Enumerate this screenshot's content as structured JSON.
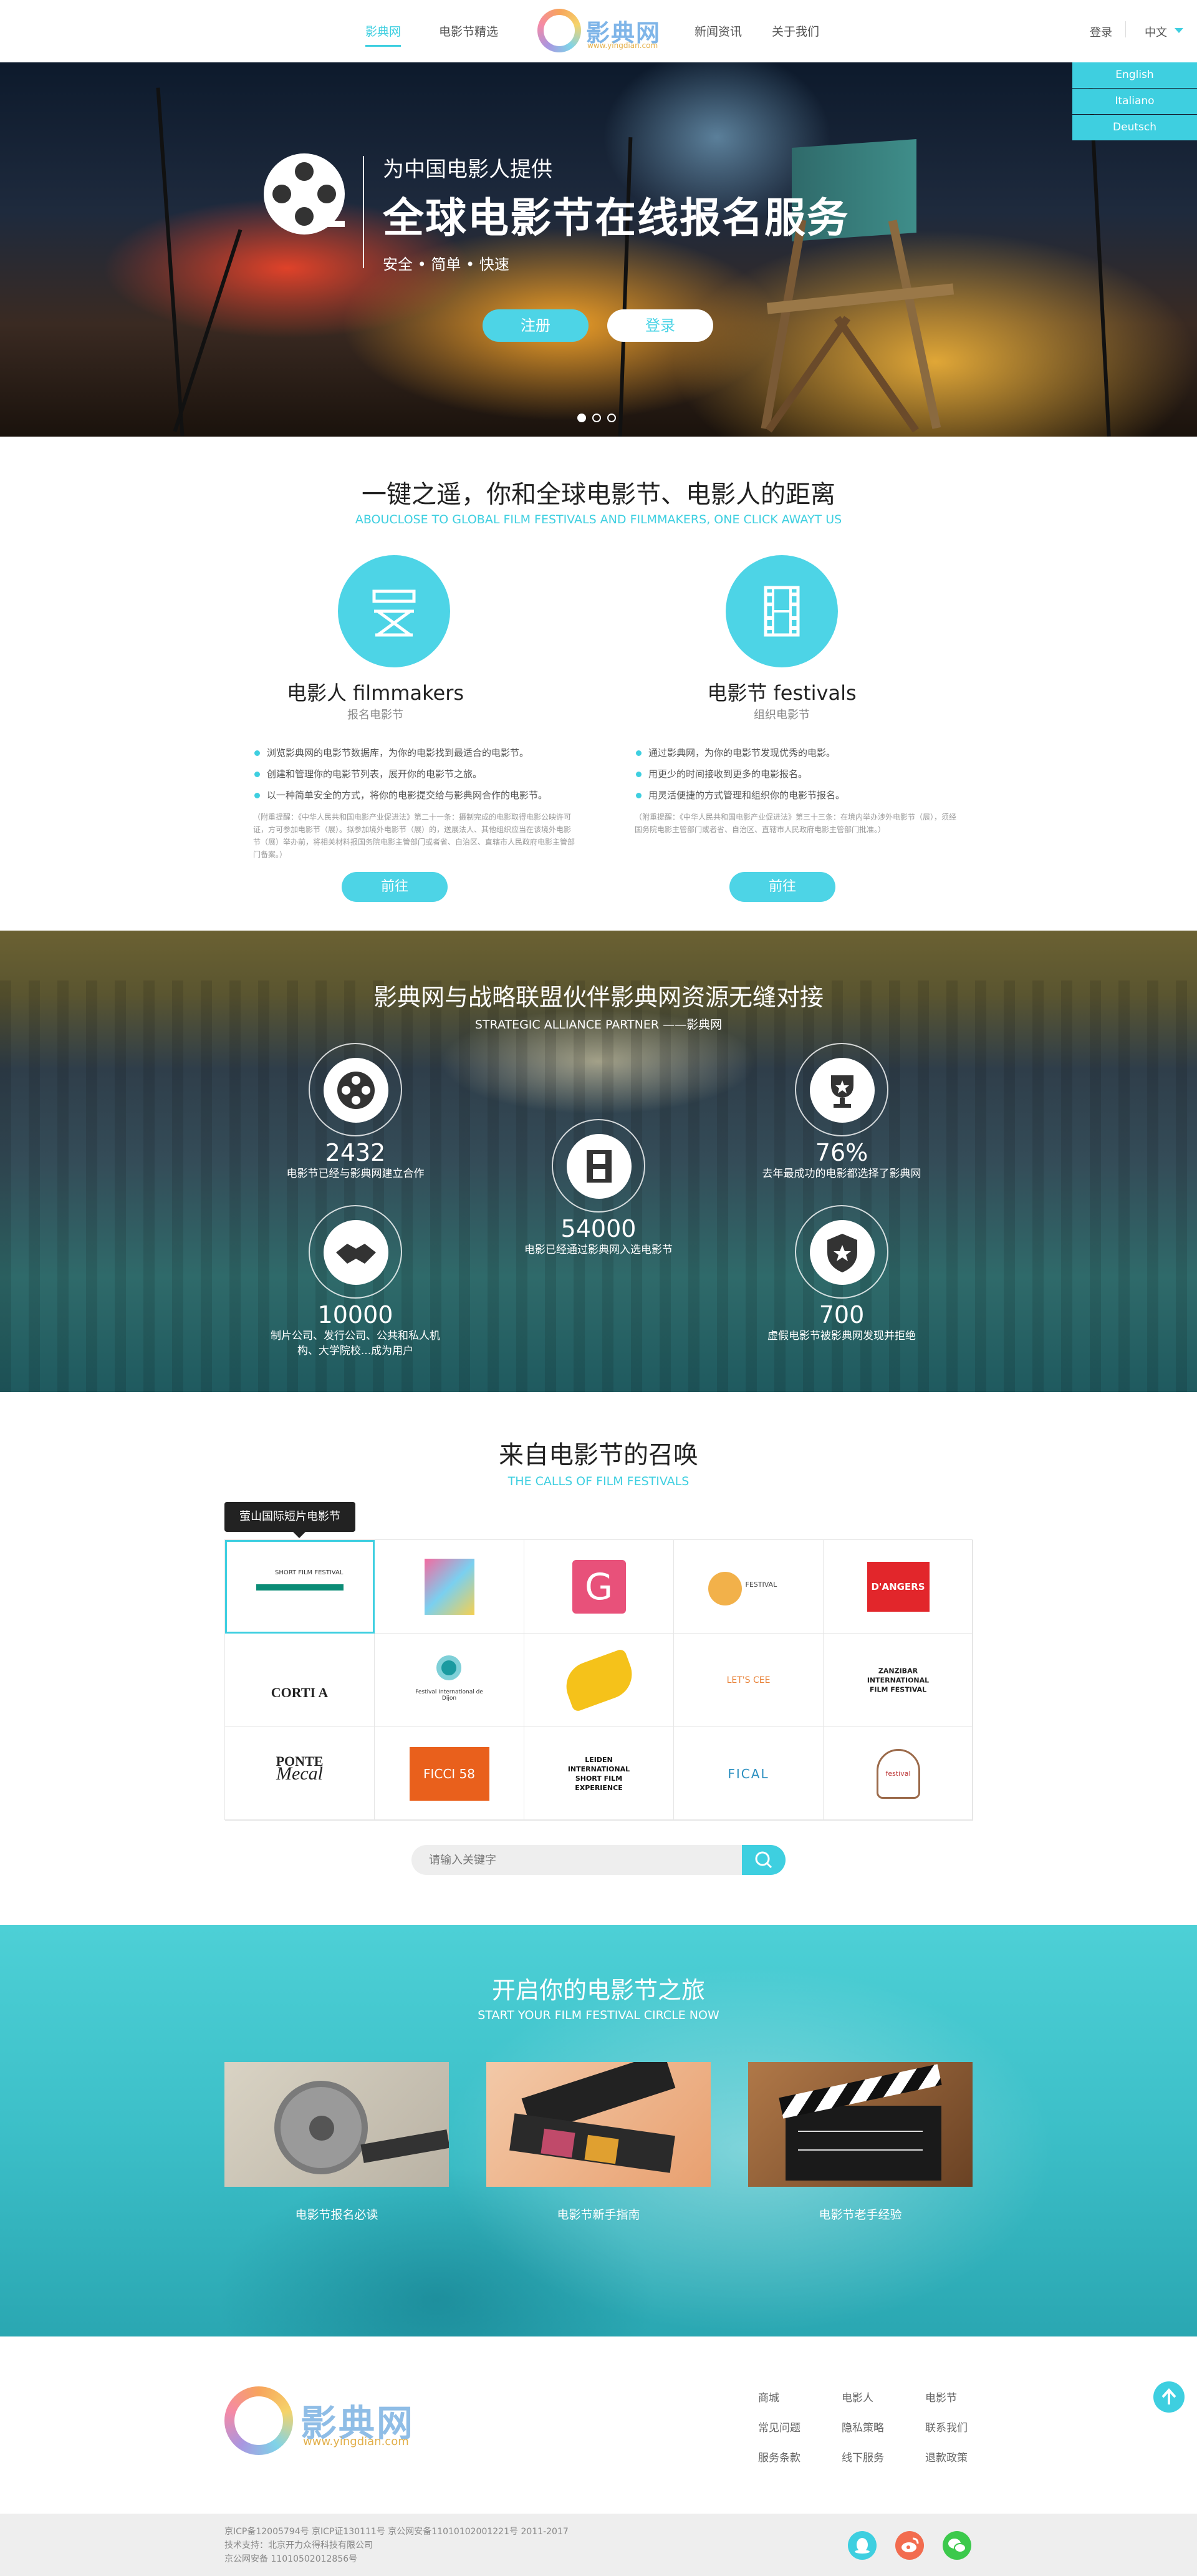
{
  "header": {
    "nav": [
      "影典网",
      "电影节精选",
      "新闻资讯",
      "关于我们"
    ],
    "logo_text": "影典网",
    "logo_sub": "www.yingdian.com",
    "login": "登录",
    "language": "中文",
    "language_options": [
      "English",
      "Italiano",
      "Deutsch"
    ],
    "accent_color": "#3ecfe0"
  },
  "hero": {
    "line1": "为中国电影人提供",
    "line2": "全球电影节在线报名服务",
    "line3": "安全 • 简单 • 快速",
    "register": "注册",
    "login": "登录",
    "slides": 3,
    "active_slide": 1
  },
  "features": {
    "title": "一键之遥，你和全球电影节、电影人的距离",
    "subtitle": "ABOUCLOSE TO GLOBAL FILM FESTIVALS AND FILMMAKERS, ONE CLICK AWAYT US",
    "items": [
      {
        "title": "电影人 filmmakers",
        "subtitle": "报名电影节",
        "icon": "directors-chair-icon",
        "bullets": [
          "浏览影典网的电影节数据库，为你的电影找到最适合的电影节。",
          "创建和管理你的电影节列表，展开你的电影节之旅。",
          "以一种简单安全的方式，将你的电影提交给与影典网合作的电影节。"
        ],
        "note": "（附重提醒：《中华人民共和国电影产业促进法》第二十一条：摄制完成的电影取得电影公映许可证，方可参加电影节（展）。拟参加境外电影节（展）的，送展法人、其他组织应当在该境外电影节（展）举办前，将相关材料报国务院电影主管部门或者省、自治区、直辖市人民政府电影主管部门备案。）",
        "button": "前往"
      },
      {
        "title": "电影节 festivals",
        "subtitle": "组织电影节",
        "icon": "film-strip-icon",
        "bullets": [
          "通过影典网，为你的电影节发现优秀的电影。",
          "用更少的时间接收到更多的电影报名。",
          "用灵活便捷的方式管理和组织你的电影节报名。"
        ],
        "note": "（附重提醒：《中华人民共和国电影产业促进法》第三十三条：在境内举办涉外电影节（展），须经国务院电影主管部门或者省、自治区、直辖市人民政府电影主管部门批准。）",
        "button": "前往"
      }
    ]
  },
  "stats": {
    "title": "影典网与战略联盟伙伴影典网资源无缝对接",
    "subtitle": "STRATEGIC ALLIANCE PARTNER ——影典网",
    "items": [
      {
        "icon": "film-reel-icon",
        "number": "2432",
        "label": "电影节已经与影典网建立合作"
      },
      {
        "icon": "film-strip-icon",
        "number": "54000",
        "label": "电影已经通过影典网入选电影节"
      },
      {
        "icon": "trophy-icon",
        "number": "76%",
        "label": "去年最成功的电影都选择了影典网"
      },
      {
        "icon": "handshake-icon",
        "number": "10000",
        "label": "制片公司、发行公司、公共和私人机构、大学院校...成为用户"
      },
      {
        "icon": "shield-star-icon",
        "number": "700",
        "label": "虚假电影节被影典网发现并拒绝"
      }
    ]
  },
  "calls": {
    "title": "来自电影节的召唤",
    "subtitle": "THE CALLS OF FILM FESTIVALS",
    "tooltip": "萤山国际短片电影节",
    "logos": [
      {
        "name": "ieri-oggi-domani",
        "text": "SHORT FILM FESTIVAL"
      },
      {
        "name": "colorful-poster",
        "text": ""
      },
      {
        "name": "g-festival",
        "text": "G"
      },
      {
        "name": "animation-festival",
        "text": "FESTIVAL"
      },
      {
        "name": "angers",
        "text": "D'ANGERS"
      },
      {
        "name": "corti-a-ponte",
        "text": "CORTI A PONTE"
      },
      {
        "name": "dijon",
        "text": "Festival International de Dijon"
      },
      {
        "name": "film-reel-yellow",
        "text": ""
      },
      {
        "name": "lets-cee",
        "text": "LET'S CEE"
      },
      {
        "name": "zanzibar",
        "text": "ZANZIBAR INTERNATIONAL FILM FESTIVAL"
      },
      {
        "name": "mecal",
        "text": "Mecal"
      },
      {
        "name": "ficci",
        "text": "FICCI 58"
      },
      {
        "name": "leiden",
        "text": "LEIDEN INTERNATIONAL SHORT FILM EXPERIENCE"
      },
      {
        "name": "fical",
        "text": "FICAL"
      },
      {
        "name": "laurel",
        "text": "festival"
      }
    ],
    "search_placeholder": "请输入关键字"
  },
  "journey": {
    "title": "开启你的电影节之旅",
    "subtitle": "START YOUR FILM FESTIVAL CIRCLE NOW",
    "cards": [
      {
        "caption": "电影节报名必读",
        "image": "film-reel-photo"
      },
      {
        "caption": "电影节新手指南",
        "image": "film-strip-photo"
      },
      {
        "caption": "电影节老手经验",
        "image": "clapperboard-photo"
      }
    ]
  },
  "footer": {
    "logo_text": "影典网",
    "logo_sub": "www.yingdian.com",
    "links": [
      "商城",
      "电影人",
      "电影节",
      "常见问题",
      "隐私策略",
      "联系我们",
      "服务条款",
      "线下服务",
      "退款政策"
    ],
    "legal": [
      "京ICP备12005794号  京ICP证130111号  京公网安备11010102001221号  2011-2017",
      "技术支持：北京开力众得科技有限公司",
      "京公网安备  11010502012856号"
    ],
    "social": [
      {
        "name": "qq-icon",
        "color": "#3ecfe0"
      },
      {
        "name": "weibo-icon",
        "color": "#f26c4f"
      },
      {
        "name": "wechat-icon",
        "color": "#3cc94c"
      }
    ]
  }
}
